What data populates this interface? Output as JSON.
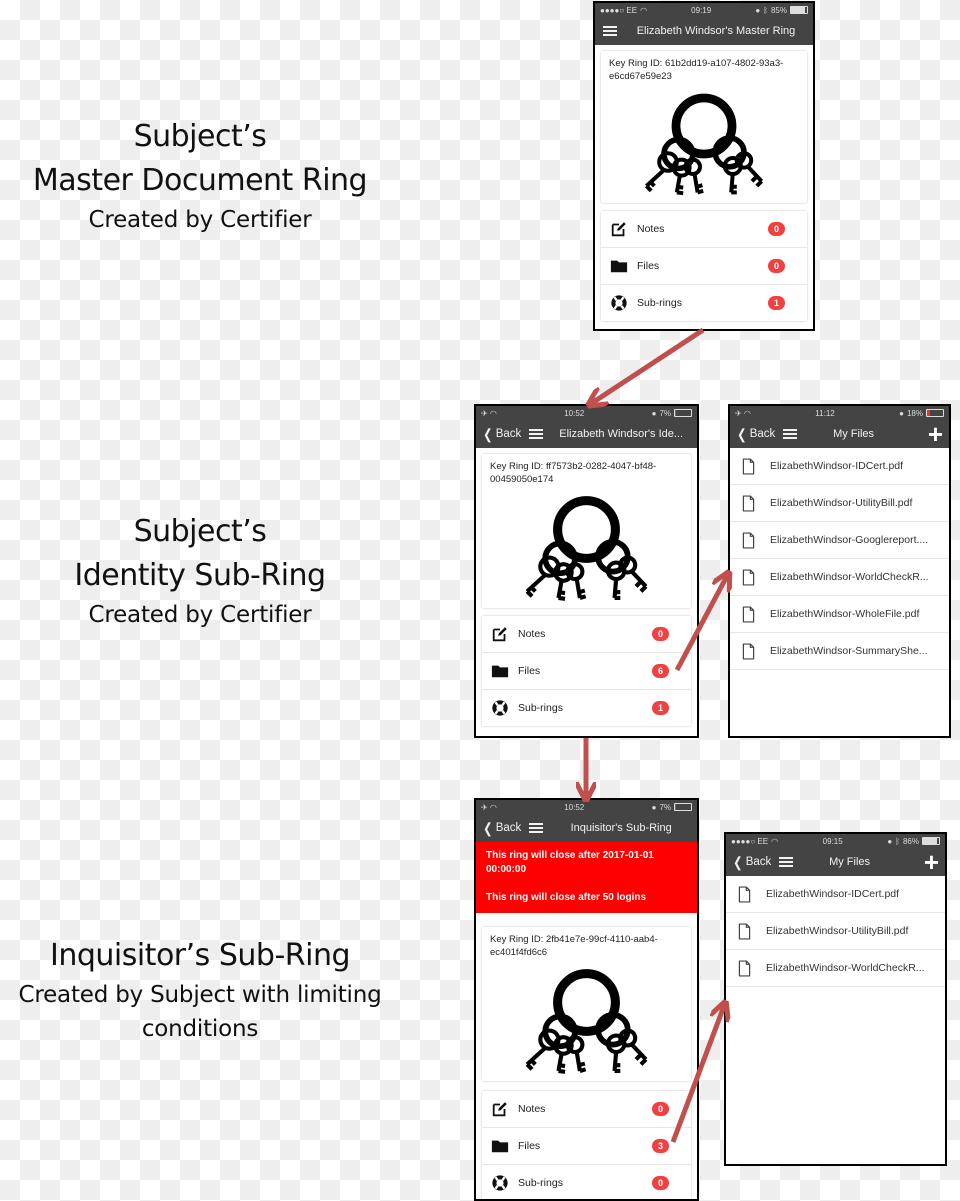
{
  "captions": [
    {
      "title_lines": [
        "Subject’s",
        "Master Document Ring"
      ],
      "subtitle_lines": [
        "Created by Certifier"
      ]
    },
    {
      "title_lines": [
        "Subject’s",
        "Identity Sub-Ring"
      ],
      "subtitle_lines": [
        "Created by Certifier"
      ]
    },
    {
      "title_lines": [
        "Inquisitor’s Sub-Ring"
      ],
      "subtitle_lines": [
        "Created by Subject with limiting",
        "conditions"
      ]
    }
  ],
  "screens": {
    "master": {
      "status": {
        "carrier": "●●●●○ EE",
        "time": "09:19",
        "battery": "85%",
        "battery_level": 0.85
      },
      "title": "Elizabeth Windsor's Master Ring",
      "key_ring_id": "Key Ring ID: 61b2dd19-a107-4802-93a3-e6cd67e59e23",
      "menu": [
        {
          "icon": "edit-note-icon",
          "label": "Notes",
          "count": "0"
        },
        {
          "icon": "folder-icon",
          "label": "Files",
          "count": "0"
        },
        {
          "icon": "lifebuoy-icon",
          "label": "Sub-rings",
          "count": "1"
        }
      ]
    },
    "identity": {
      "status": {
        "carrier": "✈ ◠",
        "time": "10:52",
        "battery": "7%",
        "battery_level": 0.07
      },
      "back_label": "Back",
      "title": "Elizabeth Windsor's Ide...",
      "key_ring_id": "Key Ring ID: ff7573b2-0282-4047-bf48-00459050e174",
      "menu": [
        {
          "icon": "edit-note-icon",
          "label": "Notes",
          "count": "0"
        },
        {
          "icon": "folder-icon",
          "label": "Files",
          "count": "6"
        },
        {
          "icon": "lifebuoy-icon",
          "label": "Sub-rings",
          "count": "1"
        }
      ]
    },
    "identity_files": {
      "status": {
        "carrier": "✈ ◠",
        "time": "11:12",
        "battery": "18%",
        "battery_level": 0.18
      },
      "back_label": "Back",
      "title": "My Files",
      "add_label": "+",
      "files": [
        "ElizabethWindsor-IDCert.pdf",
        "ElizabethWindsor-UtilityBill.pdf",
        "ElizabethWindsor-Googlereport....",
        "ElizabethWindsor-WorldCheckR...",
        "ElizabethWindsor-WholeFile.pdf",
        "ElizabethWindsor-SummaryShe..."
      ]
    },
    "inquisitor": {
      "status": {
        "carrier": "✈ ◠",
        "time": "10:52",
        "battery": "7%",
        "battery_level": 0.07
      },
      "back_label": "Back",
      "title": "Inquisitor's Sub-Ring",
      "alerts": [
        "This ring will close after 2017-01-01 00:00:00",
        "This ring will close after 50 logins"
      ],
      "alert_color": "#ff0000",
      "key_ring_id": "Key Ring ID: 2fb41e7e-99cf-4110-aab4-ec401f4fd6c6",
      "menu": [
        {
          "icon": "edit-note-icon",
          "label": "Notes",
          "count": "0"
        },
        {
          "icon": "folder-icon",
          "label": "Files",
          "count": "3"
        },
        {
          "icon": "lifebuoy-icon",
          "label": "Sub-rings",
          "count": "0"
        }
      ]
    },
    "inquisitor_files": {
      "status": {
        "carrier": "●●●●○ EE",
        "time": "09:15",
        "battery": "86%",
        "battery_level": 0.86
      },
      "back_label": "Back",
      "title": "My Files",
      "add_label": "+",
      "files": [
        "ElizabethWindsor-IDCert.pdf",
        "ElizabethWindsor-UtilityBill.pdf",
        "ElizabethWindsor-WorldCheckR..."
      ]
    }
  },
  "colors": {
    "arrow": "#c0504d",
    "navbar": "#444444",
    "badge": "#f04141"
  }
}
